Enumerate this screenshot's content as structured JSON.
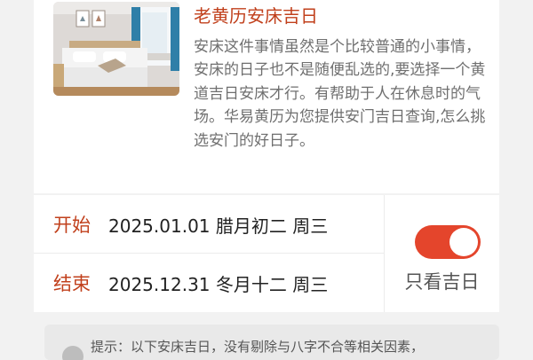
{
  "article": {
    "title": "老黄历安床吉日",
    "description": "安床这件事情虽然是个比较普通的小事情，安床的日子也不是随便乱选的,要选择一个黄道吉日安床才行。有帮助于人在休息时的气场。华易黄历为您提供安门吉日查询,怎么挑选安门的好日子。"
  },
  "date_range": {
    "start_label": "开始",
    "start_value": "2025.01.01 腊月初二 周三",
    "end_label": "结束",
    "end_value": "2025.12.31 冬月十二 周三"
  },
  "filter": {
    "label": "只看吉日",
    "enabled": true
  },
  "tip": {
    "text": "提示：以下安床吉日，没有剔除与八字不合等相关因素，"
  },
  "colors": {
    "accent": "#c1401c",
    "toggle_on": "#e4452c"
  }
}
